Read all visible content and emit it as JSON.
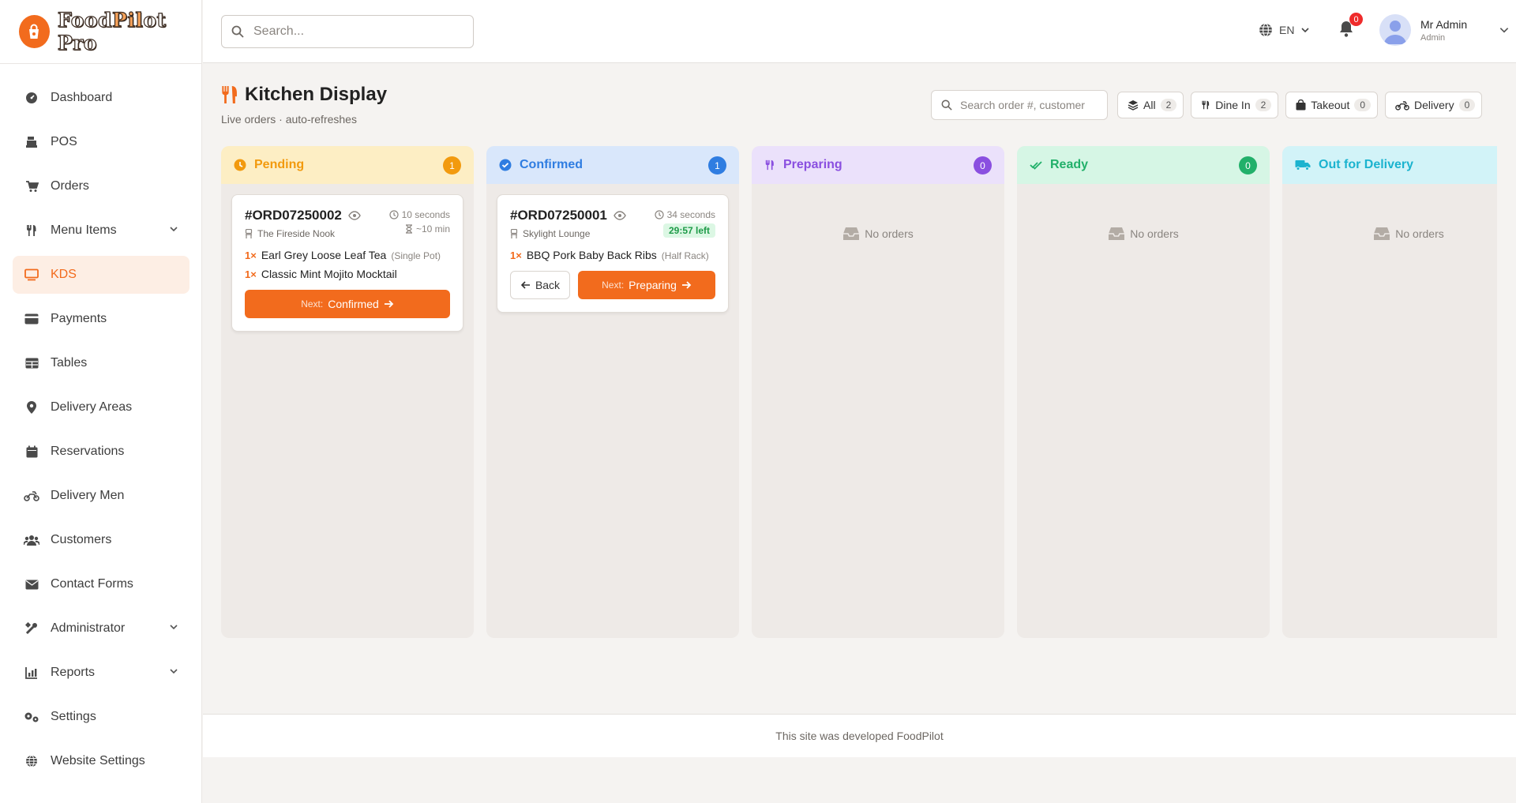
{
  "app": {
    "logo_prefix": "Food",
    "logo_accent": "Pil",
    "logo_rest": "ot",
    "logo_suffix": " Pro"
  },
  "sidebar": {
    "items": [
      {
        "label": "Dashboard",
        "icon": "gauge-icon"
      },
      {
        "label": "POS",
        "icon": "cash-register-icon"
      },
      {
        "label": "Orders",
        "icon": "cart-icon"
      },
      {
        "label": "Menu Items",
        "icon": "utensils-icon",
        "has_submenu": true
      },
      {
        "label": "KDS",
        "icon": "monitor-icon",
        "active": true
      },
      {
        "label": "Payments",
        "icon": "credit-card-icon"
      },
      {
        "label": "Tables",
        "icon": "table-icon"
      },
      {
        "label": "Delivery Areas",
        "icon": "map-pin-icon"
      },
      {
        "label": "Reservations",
        "icon": "calendar-icon"
      },
      {
        "label": "Delivery Men",
        "icon": "motorcycle-icon"
      },
      {
        "label": "Customers",
        "icon": "users-icon"
      },
      {
        "label": "Contact Forms",
        "icon": "envelope-icon"
      },
      {
        "label": "Administrator",
        "icon": "tools-icon",
        "has_submenu": true
      },
      {
        "label": "Reports",
        "icon": "chart-icon",
        "has_submenu": true
      },
      {
        "label": "Settings",
        "icon": "gears-icon"
      },
      {
        "label": "Website Settings",
        "icon": "globe-icon"
      }
    ]
  },
  "topbar": {
    "search_placeholder": "Search...",
    "language": "EN",
    "notification_count": "0",
    "user": {
      "name": "Mr Admin",
      "role": "Admin"
    }
  },
  "page": {
    "title": "Kitchen Display",
    "subtitle": "Live orders · auto-refreshes",
    "order_search_placeholder": "Search order #, customer",
    "filters": [
      {
        "label": "All",
        "count": "2",
        "icon": "layers-icon"
      },
      {
        "label": "Dine In",
        "count": "2",
        "icon": "utensils-icon"
      },
      {
        "label": "Takeout",
        "count": "0",
        "icon": "bag-icon"
      },
      {
        "label": "Delivery",
        "count": "0",
        "icon": "motorcycle-icon"
      }
    ]
  },
  "columns": [
    {
      "title": "Pending",
      "count": "1",
      "color": "#f29a0e",
      "bg": "#fdeec4",
      "icon": "clock-icon"
    },
    {
      "title": "Confirmed",
      "count": "1",
      "color": "#2f7de1",
      "bg": "#d9e7fb",
      "icon": "check-circle-icon"
    },
    {
      "title": "Preparing",
      "count": "0",
      "color": "#8a4fe0",
      "bg": "#ebe1fb",
      "icon": "utensils-icon",
      "empty_text": "No orders"
    },
    {
      "title": "Ready",
      "count": "0",
      "color": "#22b06a",
      "bg": "#d6f6e5",
      "icon": "double-check-icon",
      "empty_text": "No orders"
    },
    {
      "title": "Out for Delivery",
      "count": "0",
      "color": "#1bb3cf",
      "bg": "#d2f3f8",
      "icon": "truck-icon",
      "empty_text": "No orders"
    }
  ],
  "orders": {
    "pending": {
      "id": "#ORD07250002",
      "place": "The Fireside Nook",
      "elapsed": "10 seconds",
      "eta": "~10 min",
      "items": [
        {
          "qty": "1×",
          "name": "Earl Grey Loose Leaf Tea",
          "note": "(Single Pot)"
        },
        {
          "qty": "1×",
          "name": "Classic Mint Mojito Mocktail",
          "note": ""
        }
      ],
      "next_prefix": "Next:",
      "next_label": "Confirmed"
    },
    "confirmed": {
      "id": "#ORD07250001",
      "place": "Skylight Lounge",
      "elapsed": "34 seconds",
      "time_left": "29:57 left",
      "items": [
        {
          "qty": "1×",
          "name": "BBQ Pork Baby Back Ribs",
          "note": "(Half Rack)"
        }
      ],
      "back_label": "Back",
      "next_prefix": "Next:",
      "next_label": "Preparing"
    }
  },
  "footer": {
    "text": "This site was developed FoodPilot"
  }
}
